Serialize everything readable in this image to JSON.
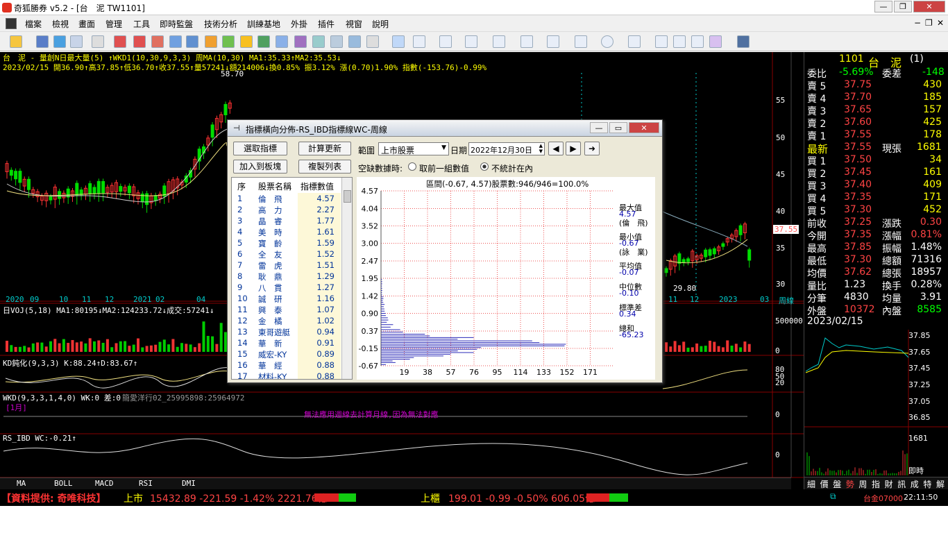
{
  "window": {
    "title": "奇狐勝券 v5.2 - [台　泥 TW1101]",
    "min": "—",
    "max": "❐",
    "close": "✕"
  },
  "menu": [
    "檔案",
    "檢視",
    "畫面",
    "管理",
    "工具",
    "即時監盤",
    "技術分析",
    "訓練基地",
    "外掛",
    "插件",
    "視窗",
    "說明"
  ],
  "chart": {
    "header1": "台　泥 - 量創N日最大量(5) ↑WKD1(10,30,9,3,3) 周MA(10,30) MA1:35.33↑MA2:35.53↓",
    "header2": "2023/02/15 開36.90↑高37.85↑低36.70↑收37.55↑量57241↓額214006↓換0.85% 振3.12% 漲(0.70)1.90% 指數(-153.76)-0.99%",
    "high_mark": "58.70",
    "low_mark": "29.80",
    "price_axis": [
      "55",
      "50",
      "45",
      "40",
      "35",
      "30"
    ],
    "last_price": "37.55",
    "date_axis": [
      "2020",
      "09",
      "10",
      "11",
      "12",
      "2021",
      "02",
      "04",
      "11",
      "12",
      "2023",
      "03",
      "周線"
    ],
    "vol_header": "日VOJ(5,18) MA1:80195↓MA2:124233.72↓成交:57241↓",
    "vol_axis": [
      "500000",
      "0"
    ],
    "kd_header": "KD鈍化(9,3,3) K:88.24↑D:83.67↑",
    "kd_axis": [
      "80",
      "50",
      "20"
    ],
    "wkd_header": "WKD(9,3,3,1,4,0) WK:0 差:0",
    "wkd_extra": "簡愛洋行02_25995898:25964972",
    "wkd_month": "[1月]",
    "wkd_msg": "無法應用週線去計算月線,因為無法對應",
    "wkd_axis": "0",
    "rs_header": "RS_IBD WC:-0.21↑",
    "rs_axis": "0",
    "tabs": [
      "MA",
      "BOLL",
      "MACD",
      "RSI",
      "DMI"
    ]
  },
  "dialog": {
    "title": "指標橫向分佈-RS_IBD指標線WC-周線",
    "btn_select": "選取指標",
    "btn_calc": "計算更新",
    "btn_add": "加入到板塊",
    "btn_copy": "複製列表",
    "range_label": "範圍",
    "range_value": "上市股票",
    "date_label": "日期",
    "date_value": "2022年12月30日",
    "missing_label": "空缺數據時:",
    "radio1": "取前一組數值",
    "radio2": "不統計在內",
    "list_headers": [
      "序",
      "股票名稱",
      "指標數值"
    ],
    "rows": [
      [
        "1",
        "倫　飛",
        "4.57"
      ],
      [
        "2",
        "高　力",
        "2.27"
      ],
      [
        "3",
        "晶　睿",
        "1.77"
      ],
      [
        "4",
        "美　時",
        "1.61"
      ],
      [
        "5",
        "寶　齡",
        "1.59"
      ],
      [
        "6",
        "全　友",
        "1.52"
      ],
      [
        "7",
        "雷　虎",
        "1.51"
      ],
      [
        "8",
        "耿　鼎",
        "1.29"
      ],
      [
        "9",
        "八　貫",
        "1.27"
      ],
      [
        "10",
        "誠　研",
        "1.16"
      ],
      [
        "11",
        "興　泰",
        "1.07"
      ],
      [
        "12",
        "金　橘",
        "1.02"
      ],
      [
        "13",
        "東哥遊艇",
        "0.94"
      ],
      [
        "14",
        "華　新",
        "0.91"
      ],
      [
        "15",
        "威宏-KY",
        "0.89"
      ],
      [
        "16",
        "華　經",
        "0.88"
      ],
      [
        "17",
        "材料-KY",
        "0.88"
      ]
    ],
    "histo_title": "區間(-0.67, 4.57)股票數:946/946=100.0%",
    "y_ticks": [
      "4.57",
      "4.04",
      "3.52",
      "3.00",
      "2.47",
      "1.95",
      "1.42",
      "0.90",
      "0.37",
      "-0.15",
      "-0.67"
    ],
    "x_ticks": [
      "19",
      "38",
      "57",
      "76",
      "95",
      "114",
      "133",
      "152",
      "171"
    ],
    "stats": [
      {
        "label": "最大值",
        "value": "4.57",
        "name": "(倫　飛)"
      },
      {
        "label": "最小值",
        "value": "-0.67",
        "name": "(詠　業)"
      },
      {
        "label": "平均值",
        "value": "-0.07"
      },
      {
        "label": "中位數",
        "value": "-0.10"
      },
      {
        "label": "標準差",
        "value": "0.34"
      },
      {
        "label": "總和",
        "value": "-65.23"
      }
    ],
    "histogram": [
      {
        "lo": 1.42,
        "hi": 1.95,
        "count": 1
      },
      {
        "lo": 1.2,
        "hi": 1.42,
        "count": 2
      },
      {
        "lo": 1.0,
        "hi": 1.2,
        "count": 3
      },
      {
        "lo": 0.8,
        "hi": 1.0,
        "count": 4
      },
      {
        "lo": 0.6,
        "hi": 0.8,
        "count": 6
      },
      {
        "lo": 0.45,
        "hi": 0.6,
        "count": 10
      },
      {
        "lo": 0.3,
        "hi": 0.45,
        "count": 20
      },
      {
        "lo": 0.2,
        "hi": 0.3,
        "count": 40
      },
      {
        "lo": 0.1,
        "hi": 0.2,
        "count": 76
      },
      {
        "lo": 0.0,
        "hi": 0.1,
        "count": 150
      },
      {
        "lo": -0.05,
        "hi": 0.0,
        "count": 175
      },
      {
        "lo": -0.1,
        "hi": -0.05,
        "count": 150
      },
      {
        "lo": -0.2,
        "hi": -0.1,
        "count": 95
      },
      {
        "lo": -0.3,
        "hi": -0.2,
        "count": 76
      },
      {
        "lo": -0.4,
        "hi": -0.3,
        "count": 57
      },
      {
        "lo": -0.5,
        "hi": -0.4,
        "count": 30
      },
      {
        "lo": -0.6,
        "hi": -0.5,
        "count": 12
      },
      {
        "lo": -0.67,
        "hi": -0.6,
        "count": 4
      }
    ]
  },
  "quote": {
    "code": "1101",
    "name": "台　泥",
    "suffix": "(1)",
    "ratio_label": "委比",
    "ratio": "-5.69%",
    "diff_label": "委差",
    "diff": "-148",
    "asks": [
      [
        "賣 5",
        "37.75",
        "430"
      ],
      [
        "賣 4",
        "37.70",
        "185"
      ],
      [
        "賣 3",
        "37.65",
        "157"
      ],
      [
        "賣 2",
        "37.60",
        "425"
      ],
      [
        "賣 1",
        "37.55",
        "178"
      ]
    ],
    "last_label": "最新",
    "last": "37.55",
    "vol_label": "現張",
    "vol": "1681",
    "bids": [
      [
        "買 1",
        "37.50",
        "34"
      ],
      [
        "買 2",
        "37.45",
        "161"
      ],
      [
        "買 3",
        "37.40",
        "409"
      ],
      [
        "買 4",
        "37.35",
        "171"
      ],
      [
        "買 5",
        "37.30",
        "452"
      ]
    ],
    "stats": [
      [
        "前收",
        "37.25",
        "漲跌",
        "0.30"
      ],
      [
        "今開",
        "37.35",
        "漲幅",
        "0.81%"
      ],
      [
        "最高",
        "37.85",
        "振幅",
        "1.48%"
      ],
      [
        "最低",
        "37.30",
        "總額",
        "71316"
      ],
      [
        "均價",
        "37.62",
        "總張",
        "18957"
      ],
      [
        "量比",
        "1.23",
        "換手",
        "0.28%"
      ],
      [
        "分筆",
        "4830",
        "均量",
        "3.91"
      ],
      [
        "外盤",
        "10372",
        "內盤",
        "8585"
      ]
    ],
    "date": "2023/02/15",
    "mini_axis": [
      "37.85",
      "37.65",
      "37.45",
      "37.25",
      "37.05",
      "36.85",
      "1681"
    ],
    "mini_label": "即時",
    "tabs": [
      "細",
      "價",
      "盤",
      "勢",
      "周",
      "指",
      "財",
      "訊",
      "成",
      "特",
      "解"
    ]
  },
  "statusbar": {
    "provider": "【資料提供: 奇唯科技】",
    "twse_label": "上市",
    "twse": "15432.89 -221.59 -1.42% 2221.76億",
    "otc_label": "上櫃",
    "otc": "199.01 -0.99 -0.50% 606.05億",
    "connection": "台金07000",
    "time": "22:11:50"
  }
}
